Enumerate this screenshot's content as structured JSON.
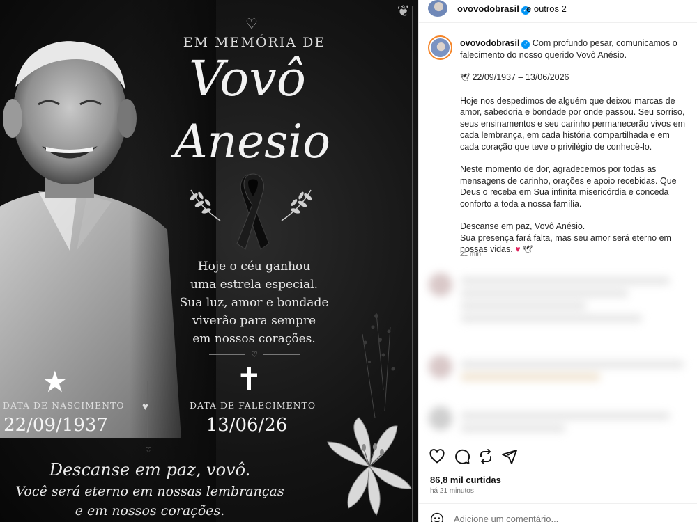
{
  "memorial": {
    "heading": "EM MEMÓRIA DE",
    "name_line1": "Vovô",
    "name_line2": "Anesio",
    "quote": [
      "Hoje o céu ganhou",
      "uma estrela especial.",
      "Sua luz, amor e bondade",
      "viverão para sempre",
      "em nossos corações."
    ],
    "birth_label": "DATA DE NASCIMENTO",
    "birth_date": "22/09/1937",
    "death_label": "DATA DE FALECIMENTO",
    "death_date": "13/06/26",
    "farewell_line1": "Descanse em paz, vovô.",
    "farewell_line2": "Você será eterno em nossas lembranças",
    "farewell_line3": "e em nossos corações."
  },
  "header": {
    "username": "ovovodobrasil",
    "others": "e outros 2"
  },
  "caption": {
    "username": "ovovodobrasil",
    "intro": "Com profundo pesar, comunicamos o falecimento do nosso querido Vovô Anésio.",
    "dates": "22/09/1937 – 13/06/2026",
    "p1": "Hoje nos despedimos de alguém que deixou marcas de amor, sabedoria e bondade por onde passou. Seu sorriso, seus ensinamentos e seu carinho permanecerão vivos em cada lembrança, em cada história compartilhada e em cada coração que teve o privilégio de conhecê-lo.",
    "p2": "Neste momento de dor, agradecemos por todas as mensagens de carinho, orações e apoio recebidas. Que Deus o receba em Sua infinita misericórdia e conceda conforto a toda a nossa família.",
    "p3_line1": "Descanse em paz, Vovô Anésio.",
    "p3_line2": "Sua presença fará falta, mas seu amor será eterno em nossas vidas.",
    "time": "21 min"
  },
  "post": {
    "likes": "86,8 mil curtidas",
    "time": "há 21 minutos",
    "comment_placeholder": "Adicione um comentário..."
  },
  "colors": {
    "verified": "#0095f6",
    "story_ring": "#f58529",
    "heart_emoji": "#e0245e",
    "image_background": "#141414"
  },
  "icons": [
    "verified-icon",
    "dove-icon",
    "heart-icon",
    "comment-icon",
    "share-icon",
    "send-icon",
    "emoji-icon",
    "star-icon",
    "cross-icon",
    "ribbon-icon"
  ]
}
